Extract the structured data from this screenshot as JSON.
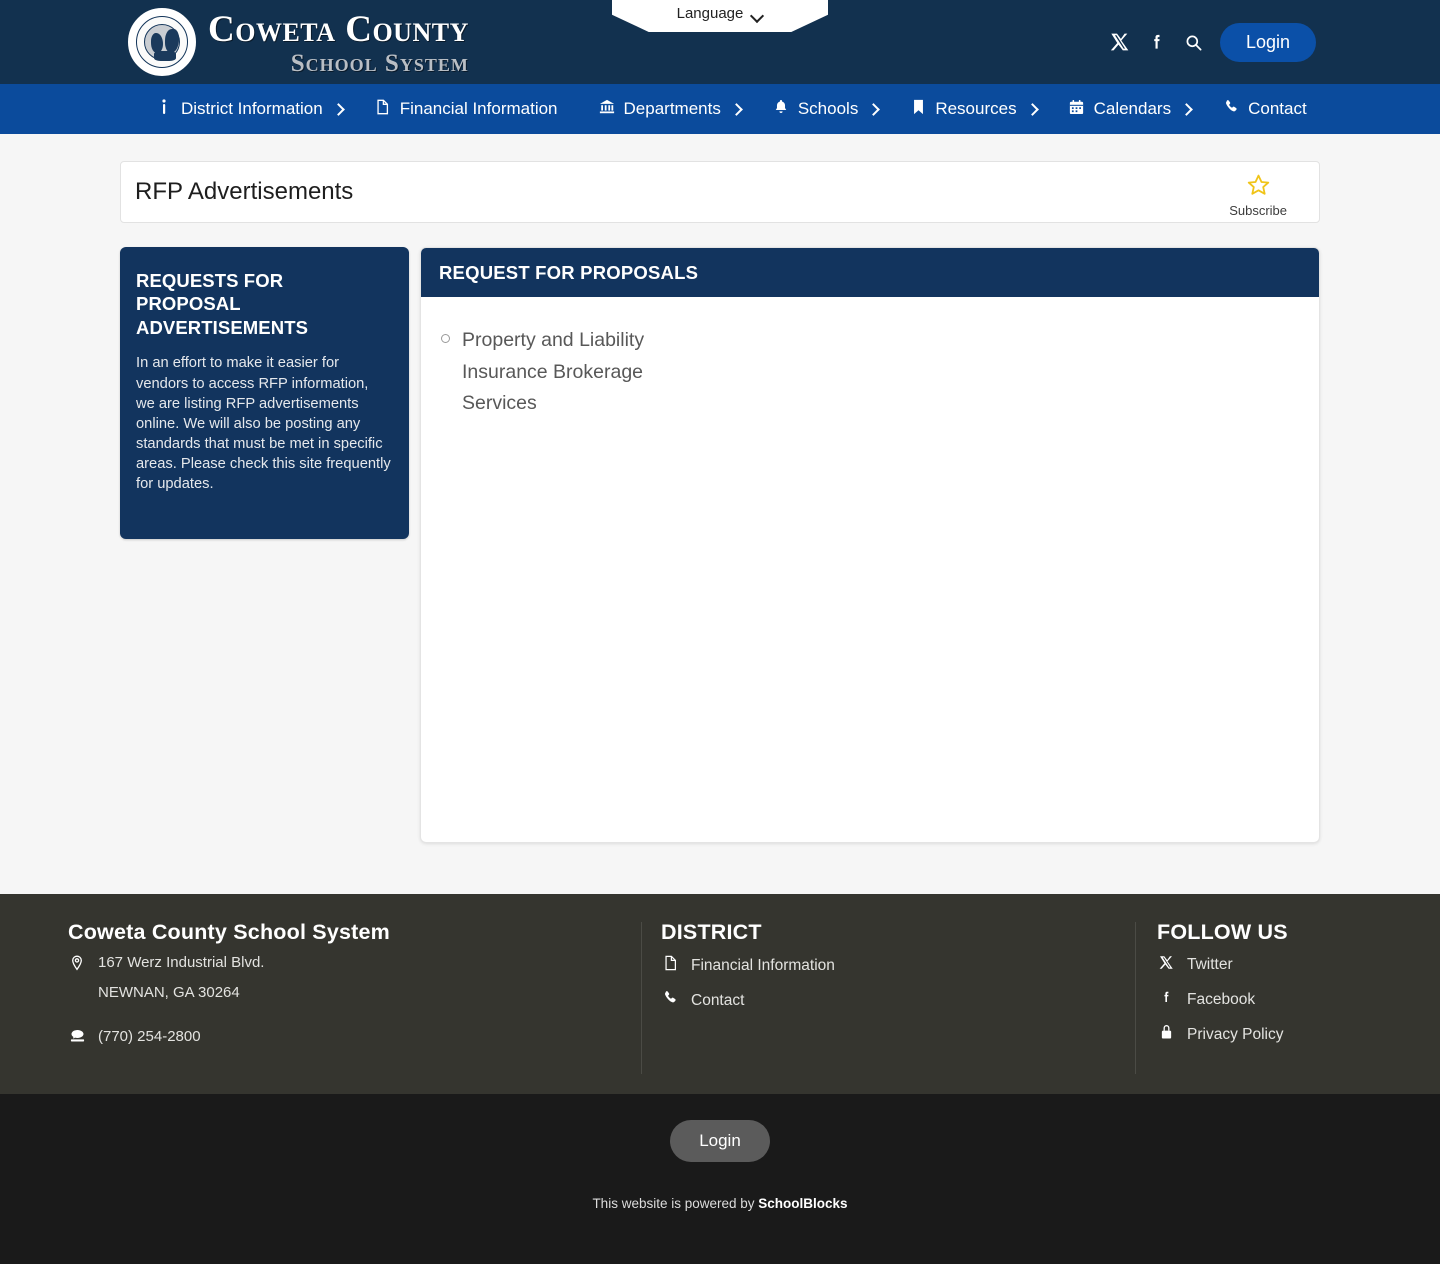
{
  "header": {
    "logo_main": "Coweta County",
    "logo_sub": "School System",
    "seal_icon": "county-seal-icon",
    "language": {
      "label": "Language",
      "caret_icon": "chevron-down-icon"
    },
    "social": [
      {
        "name": "twitter-x-icon",
        "glyph": "𝕏"
      },
      {
        "name": "facebook-icon",
        "glyph": "f"
      }
    ],
    "search_icon": "search-icon",
    "login_label": "Login"
  },
  "nav": {
    "items": [
      {
        "label": "District Information",
        "icon": "info-icon",
        "glyph": "ℹ",
        "has_submenu": true
      },
      {
        "label": "Financial Information",
        "icon": "document-icon",
        "glyph": "🗎",
        "has_submenu": false
      },
      {
        "label": "Departments",
        "icon": "bank-icon",
        "glyph": "🏛",
        "has_submenu": true
      },
      {
        "label": "Schools",
        "icon": "bell-icon",
        "glyph": "🔔",
        "has_submenu": true
      },
      {
        "label": "Resources",
        "icon": "bookmark-icon",
        "glyph": "🔖",
        "has_submenu": true
      },
      {
        "label": "Calendars",
        "icon": "calendar-icon",
        "glyph": "📅",
        "has_submenu": true
      },
      {
        "label": "Contact",
        "icon": "phone-icon",
        "glyph": "📞",
        "has_submenu": false
      }
    ]
  },
  "page": {
    "title": "RFP Advertisements",
    "subscribe_label": "Subscribe",
    "subscribe_icon": "star-icon",
    "star_color": "#f0c419"
  },
  "sidebar_card": {
    "heading": "REQUESTS FOR PROPOSAL ADVERTISEMENTS",
    "body": "In an effort to make it easier for vendors to access RFP information, we are listing RFP advertisements online. We will also be posting any standards that must be met in specific areas. Please check this site frequently for updates.",
    "background": "#12345e"
  },
  "panel": {
    "heading": "REQUEST FOR PROPOSALS",
    "items": [
      {
        "label": "Property and Liability Insurance Brokerage Services",
        "bullet_icon": "circle-bullet-icon"
      }
    ]
  },
  "footer": {
    "org": {
      "name": "Coweta County School System",
      "address_icon": "location-marker-icon",
      "address_line1": "167 Werz Industrial Blvd.",
      "address_line2": "NEWNAN, GA 30264",
      "phone_icon": "telephone-icon",
      "phone": "(770) 254-2800"
    },
    "district": {
      "heading": "DISTRICT",
      "links": [
        {
          "label": "Financial Information",
          "icon": "document-icon",
          "glyph": "🗎"
        },
        {
          "label": "Contact",
          "icon": "phone-icon",
          "glyph": "📞"
        }
      ]
    },
    "follow": {
      "heading": "FOLLOW US",
      "links": [
        {
          "label": "Twitter",
          "icon": "twitter-x-icon",
          "glyph": "𝕏"
        },
        {
          "label": "Facebook",
          "icon": "facebook-icon",
          "glyph": "f"
        },
        {
          "label": "Privacy Policy",
          "icon": "lock-icon",
          "glyph": "🔒"
        }
      ]
    },
    "bottom": {
      "login_label": "Login",
      "powered_prefix": "This website is powered by ",
      "powered_brand": "SchoolBlocks"
    }
  }
}
